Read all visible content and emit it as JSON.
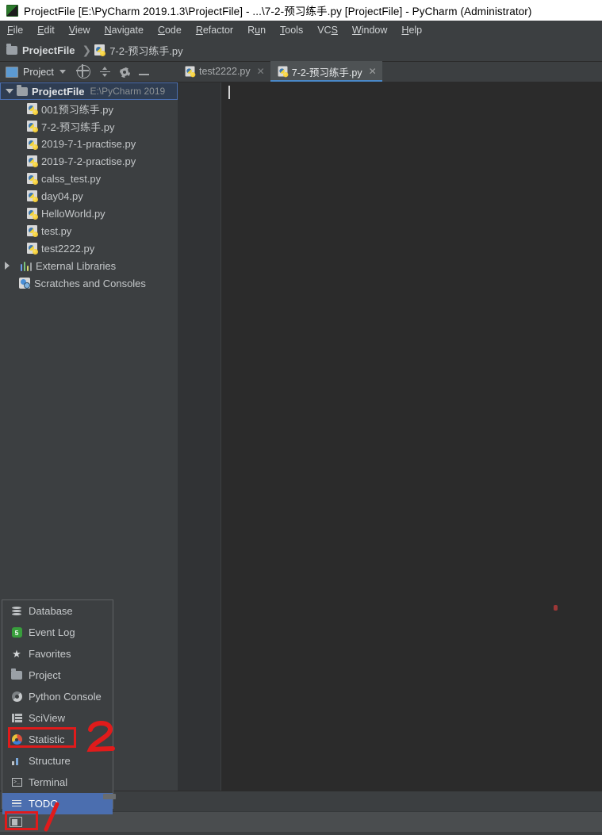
{
  "window": {
    "title": "ProjectFile [E:\\PyCharm 2019.1.3\\ProjectFile] - ...\\7-2-预习练手.py [ProjectFile] - PyCharm (Administrator)",
    "app_icon": "pycharm-icon"
  },
  "menubar": {
    "items": [
      {
        "label": "File",
        "mnemonic": "F"
      },
      {
        "label": "Edit",
        "mnemonic": "E"
      },
      {
        "label": "View",
        "mnemonic": "V"
      },
      {
        "label": "Navigate",
        "mnemonic": "N"
      },
      {
        "label": "Code",
        "mnemonic": "C"
      },
      {
        "label": "Refactor",
        "mnemonic": "R"
      },
      {
        "label": "Run",
        "mnemonic": "u"
      },
      {
        "label": "Tools",
        "mnemonic": "T"
      },
      {
        "label": "VCS",
        "mnemonic": "S"
      },
      {
        "label": "Window",
        "mnemonic": "W"
      },
      {
        "label": "Help",
        "mnemonic": "H"
      }
    ]
  },
  "breadcrumb": {
    "separator": "❯",
    "items": [
      {
        "label": "ProjectFile",
        "icon": "folder-icon"
      },
      {
        "label": "7-2-预习练手.py",
        "icon": "python-file-icon"
      }
    ]
  },
  "toolwindow": {
    "title": "Project",
    "buttons": [
      {
        "name": "locate-icon"
      },
      {
        "name": "collapse-all-icon"
      },
      {
        "name": "settings-gear-icon"
      },
      {
        "name": "hide-icon"
      }
    ]
  },
  "tabs": [
    {
      "label": "test2222.py",
      "active": false,
      "close": "✕"
    },
    {
      "label": "7-2-预习练手.py",
      "active": true,
      "close": "✕"
    }
  ],
  "tree": {
    "root": {
      "label": "ProjectFile",
      "path": "E:\\PyCharm 2019",
      "expanded": true
    },
    "files": [
      "001预习练手.py",
      "7-2-预习练手.py",
      "2019-7-1-practise.py",
      "2019-7-2-practise.py",
      "calss_test.py",
      "day04.py",
      "HelloWorld.py",
      "test.py",
      "test2222.py"
    ],
    "external_libraries": "External Libraries",
    "scratches": "Scratches and Consoles"
  },
  "popup_menu": {
    "items": [
      {
        "label": "Database",
        "icon": "database-icon",
        "selected": false
      },
      {
        "label": "Event Log",
        "icon": "event-log-icon",
        "selected": false,
        "badge": "5"
      },
      {
        "label": "Favorites",
        "icon": "star-icon",
        "selected": false
      },
      {
        "label": "Project",
        "icon": "folder-icon",
        "selected": false
      },
      {
        "label": "Python Console",
        "icon": "python-console-icon",
        "selected": false
      },
      {
        "label": "SciView",
        "icon": "sciview-icon",
        "selected": false
      },
      {
        "label": "Statistic",
        "icon": "statistic-icon",
        "selected": false
      },
      {
        "label": "Structure",
        "icon": "structure-icon",
        "selected": false
      },
      {
        "label": "Terminal",
        "icon": "terminal-icon",
        "selected": false
      },
      {
        "label": "TODO",
        "icon": "todo-icon",
        "selected": true
      }
    ]
  },
  "bottom_bar": {
    "hide_windows_label": "",
    "hide_windows_icon": "hide-windows-icon"
  },
  "annotations": [
    {
      "name": "callout-1",
      "text": "1",
      "target": "hide-windows-button"
    },
    {
      "name": "callout-2",
      "text": "2",
      "target": "statistic-menu-item"
    }
  ],
  "colors": {
    "accent_blue": "#4b6eaf",
    "tab_underline": "#4a88c7",
    "annotation_red": "#e01b1b",
    "panel_bg": "#3c3f41",
    "editor_bg": "#2b2b2b"
  }
}
